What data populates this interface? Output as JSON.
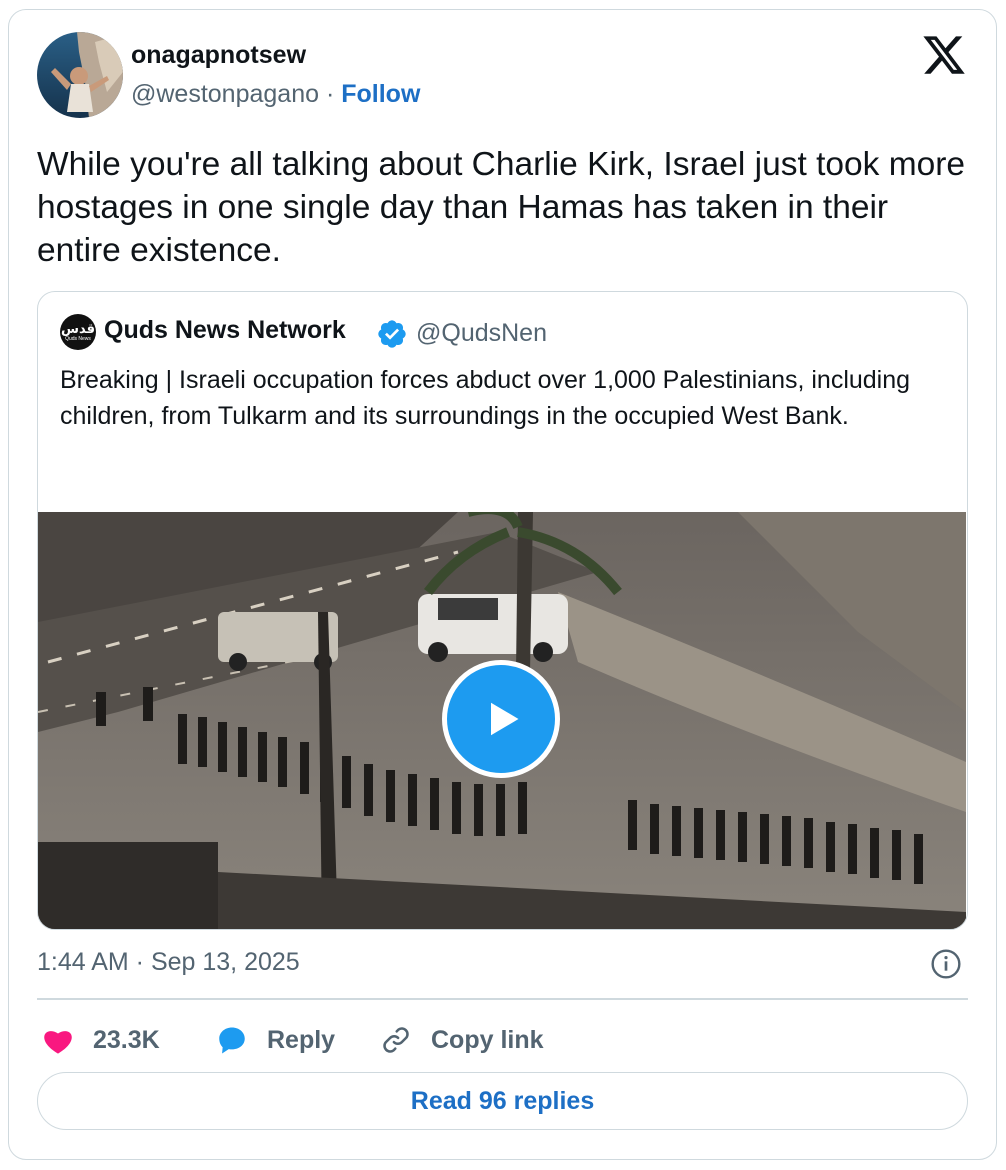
{
  "author": {
    "display_name": "onagapnotsew",
    "handle": "@westonpagano",
    "separator": "·",
    "follow_label": "Follow"
  },
  "tweet": {
    "text": "While you're all talking about Charlie Kirk, Israel just took more hostages in one single day than Hamas has taken in their entire existence."
  },
  "quoted_tweet": {
    "avatar_text_ar": "قدس",
    "avatar_text_en": "Quds News",
    "display_name": "Quds News Network",
    "handle": "@QudsNen",
    "verified": true,
    "text": "Breaking | Israeli occupation forces abduct over 1,000 Palestinians, including children, from Tulkarm and its surroundings in the occupied West Bank.",
    "media": {
      "type": "video",
      "icon": "play-icon"
    }
  },
  "timestamp": "1:44 AM · Sep 13, 2025",
  "actions": {
    "like_count": "23.3K",
    "reply_label": "Reply",
    "copy_label": "Copy link"
  },
  "read_replies_label": "Read 96 replies",
  "colors": {
    "like": "#f91880",
    "reply": "#1d9bf0",
    "link": "#1d6fc5",
    "muted": "#536471",
    "border": "#cfd9de",
    "verified": "#1d9bf0"
  }
}
